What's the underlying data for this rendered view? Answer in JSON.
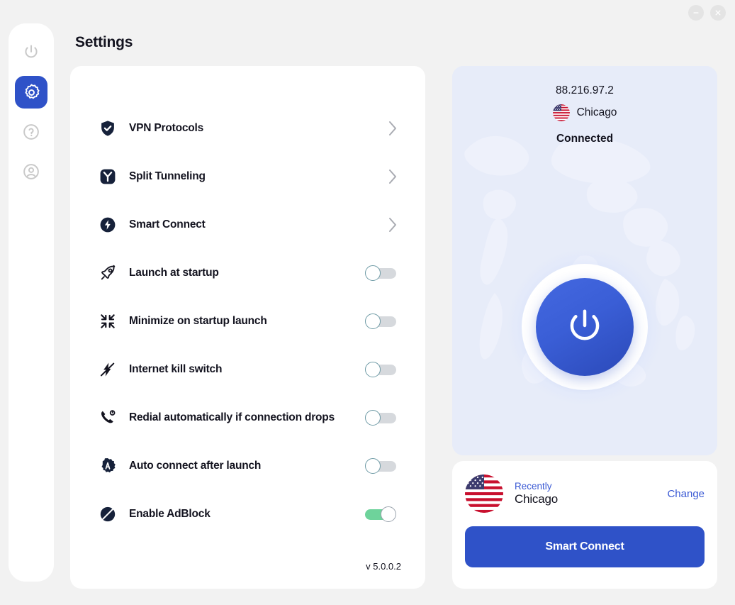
{
  "window": {
    "minimize_icon": "minimize-icon",
    "close_icon": "close-icon"
  },
  "sidebar": {
    "items": [
      {
        "icon": "power-icon",
        "name": "power",
        "active": false
      },
      {
        "icon": "gear-icon",
        "name": "settings",
        "active": true
      },
      {
        "icon": "help-circle-icon",
        "name": "help",
        "active": false
      },
      {
        "icon": "account-circle-icon",
        "name": "account",
        "active": false
      }
    ]
  },
  "header": {
    "title": "Settings"
  },
  "settings": {
    "version": "v 5.0.0.2",
    "rows": [
      {
        "label": "VPN Protocols",
        "icon": "shield-check-icon",
        "control": "chevron"
      },
      {
        "label": "Split Tunneling",
        "icon": "split-tunnel-icon",
        "control": "chevron"
      },
      {
        "label": "Smart Connect",
        "icon": "lightning-bolt-icon",
        "control": "chevron"
      },
      {
        "label": "Launch at startup",
        "icon": "rocket-icon",
        "control": "toggle",
        "on": false
      },
      {
        "label": "Minimize on startup launch",
        "icon": "minimize-arrows-icon",
        "control": "toggle",
        "on": false
      },
      {
        "label": "Internet kill switch",
        "icon": "kill-switch-icon",
        "control": "toggle",
        "on": false
      },
      {
        "label": "Redial automatically if connection drops",
        "icon": "redial-phone-icon",
        "control": "toggle",
        "on": false
      },
      {
        "label": "Auto connect after launch",
        "icon": "auto-connect-badge-icon",
        "control": "toggle",
        "on": false
      },
      {
        "label": "Enable AdBlock",
        "icon": "adblock-icon",
        "control": "toggle",
        "on": true
      }
    ]
  },
  "status_panel": {
    "ip_address": "88.216.97.2",
    "location": "Chicago",
    "flag_icon": "us-flag-icon",
    "connection_state": "Connected",
    "power_button_icon": "power-icon"
  },
  "recent_card": {
    "flag_icon": "us-flag-icon",
    "recent_label": "Recently",
    "city": "Chicago",
    "change_label": "Change",
    "smart_connect_label": "Smart Connect"
  },
  "colors": {
    "accent": "#2f52c8",
    "accent_link": "#3b5ad4",
    "toggle_on": "#6ed39b",
    "toggle_off": "#d6d9dd",
    "panel_bg": "#e7ecf9",
    "page_bg": "#f2f2f2",
    "text": "#13131f"
  }
}
